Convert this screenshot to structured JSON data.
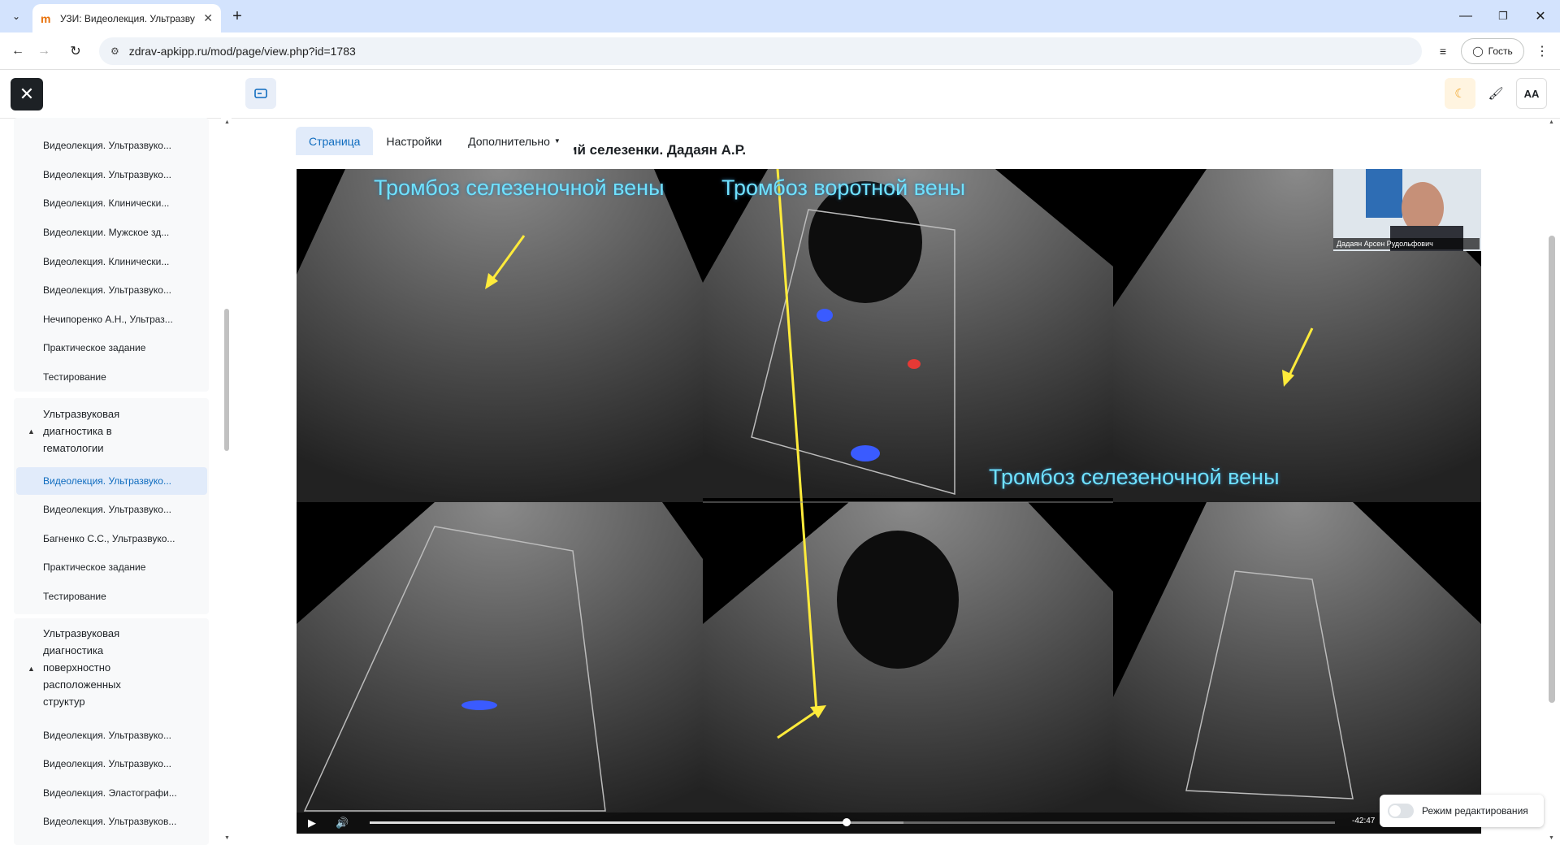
{
  "browser": {
    "tab_title": "УЗИ: Видеолекция. Ультразву",
    "tab_close": "✕",
    "new_tab": "+",
    "url": "zdrav-apkipp.ru/mod/page/view.php?id=1783",
    "profile_label": "Гость",
    "window_controls": [
      "—",
      "❐",
      "✕"
    ]
  },
  "sidebar": {
    "close_label": "✕",
    "group1_items": [
      "Видеолекция. Ультразвуко...",
      "Видеолекция. Ультразвуко...",
      "Видеолекция. Клинически...",
      "Видеолекции. Мужское зд...",
      "Видеолекция. Клинически...",
      "Видеолекция. Ультразвуко...",
      "Нечипоренко А.Н., Ультраз...",
      "Практическое задание",
      "Тестирование"
    ],
    "section2_title": "Ультразвуковая диагностика в гематологии",
    "group2_items": [
      "Видеолекция. Ультразвуко...",
      "Видеолекция. Ультразвуко...",
      "Багненко С.С., Ультразвуко...",
      "Практическое задание",
      "Тестирование"
    ],
    "section3_title": "Ультразвуковая диагностика поверхностно расположенных структур",
    "group3_items": [
      "Видеолекция. Ультразвуко...",
      "Видеолекция. Ультразвуко...",
      "Видеолекция. Эластографи...",
      "Видеолекция. Ультразвуков..."
    ]
  },
  "header": {
    "font_size_label": "AA"
  },
  "nav_tabs": [
    "Страница",
    "Настройки",
    "Дополнительно"
  ],
  "page_heading": "ий селезенки. Дадаян А.Р.",
  "video": {
    "titles": [
      "Тромбоз селезеночной вены",
      "Тромбоз воротной вены",
      "Тромбоз селезеночной вены"
    ],
    "speaker_name": "Дадаян Арсен Рудольфович",
    "time_remaining": "-42:47",
    "progress_fraction": 0.494
  },
  "edit_mode_label": "Режим редактирования",
  "colors": {
    "accent": "#0f6cbf",
    "active_bg": "#e1ebfa",
    "overlay_text": "#6fe1ff",
    "arrow": "#ffeb3b"
  }
}
